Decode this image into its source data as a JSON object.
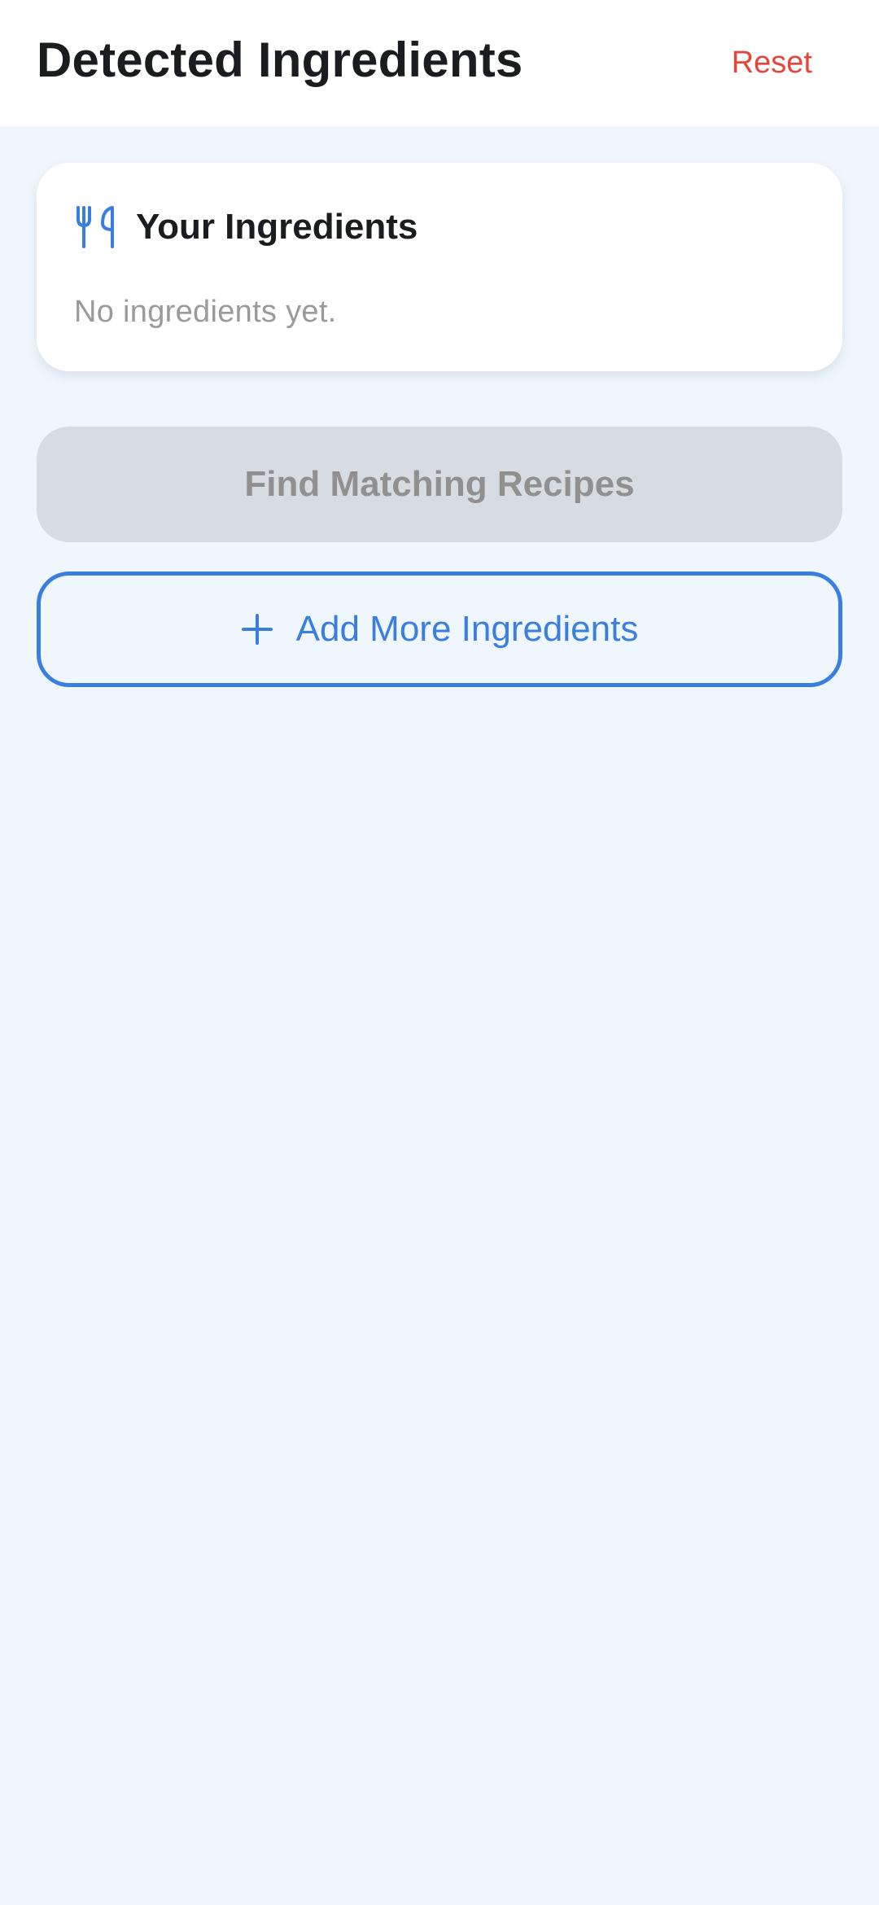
{
  "header": {
    "title": "Detected Ingredients",
    "reset_label": "Reset"
  },
  "ingredients_card": {
    "icon": "utensils-icon",
    "title": "Your Ingredients",
    "empty_text": "No ingredients yet."
  },
  "actions": {
    "find_label": "Find Matching Recipes",
    "find_disabled": true,
    "add_label": "Add More Ingredients",
    "add_icon": "plus-icon"
  },
  "colors": {
    "background": "#eff6fd",
    "accent": "#3a7fe0",
    "reset": "#e5453a",
    "disabled_bg": "#d7dce2",
    "disabled_text": "#909090",
    "muted_text": "#9a9a9a"
  }
}
